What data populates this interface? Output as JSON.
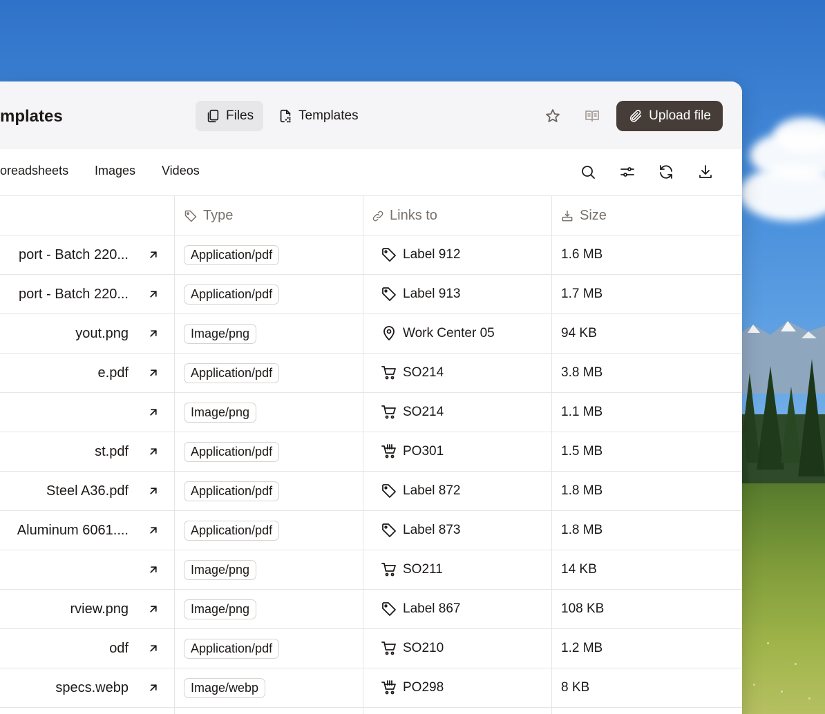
{
  "header": {
    "title": "mplates",
    "tabs": [
      {
        "label": "Files",
        "icon": "files-icon",
        "active": true
      },
      {
        "label": "Templates",
        "icon": "template-icon",
        "active": false
      }
    ],
    "actions": {
      "star_icon": "star-icon",
      "book_icon": "book-icon"
    },
    "upload_label": "Upload file"
  },
  "filters": [
    "oreadsheets",
    "Images",
    "Videos"
  ],
  "tools": [
    "search-icon",
    "sliders-icon",
    "refresh-icon",
    "download-icon"
  ],
  "columns": {
    "type": "Type",
    "links": "Links to",
    "size": "Size"
  },
  "rows": [
    {
      "name": "port - Batch 220...",
      "type": "Application/pdf",
      "link_icon": "tag-icon",
      "link": "Label 912",
      "size": "1.6 MB"
    },
    {
      "name": "port - Batch 220...",
      "type": "Application/pdf",
      "link_icon": "tag-icon",
      "link": "Label 913",
      "size": "1.7 MB"
    },
    {
      "name": "yout.png",
      "type": "Image/png",
      "link_icon": "location-pin-icon",
      "link": "Work Center 05",
      "size": "94 KB"
    },
    {
      "name": "e.pdf",
      "type": "Application/pdf",
      "link_icon": "cart-icon",
      "link": "SO214",
      "size": "3.8 MB"
    },
    {
      "name": "",
      "type": "Image/png",
      "link_icon": "cart-icon",
      "link": "SO214",
      "size": "1.1 MB"
    },
    {
      "name": "st.pdf",
      "type": "Application/pdf",
      "link_icon": "purchase-cart-icon",
      "link": "PO301",
      "size": "1.5 MB"
    },
    {
      "name": "Steel A36.pdf",
      "type": "Application/pdf",
      "link_icon": "tag-icon",
      "link": "Label 872",
      "size": "1.8 MB"
    },
    {
      "name": "Aluminum 6061....",
      "type": "Application/pdf",
      "link_icon": "tag-icon",
      "link": "Label 873",
      "size": "1.8 MB"
    },
    {
      "name": "",
      "type": "Image/png",
      "link_icon": "cart-icon",
      "link": "SO211",
      "size": "14 KB"
    },
    {
      "name": "rview.png",
      "type": "Image/png",
      "link_icon": "tag-icon",
      "link": "Label 867",
      "size": "108 KB"
    },
    {
      "name": "odf",
      "type": "Application/pdf",
      "link_icon": "cart-icon",
      "link": "SO210",
      "size": "1.2 MB"
    },
    {
      "name": "specs.webp",
      "type": "Image/webp",
      "link_icon": "purchase-cart-icon",
      "link": "PO298",
      "size": "8 KB"
    }
  ],
  "colors": {
    "upload_button": "#463d38",
    "header_bg": "#f5f4f6",
    "muted_text": "#78716c"
  }
}
